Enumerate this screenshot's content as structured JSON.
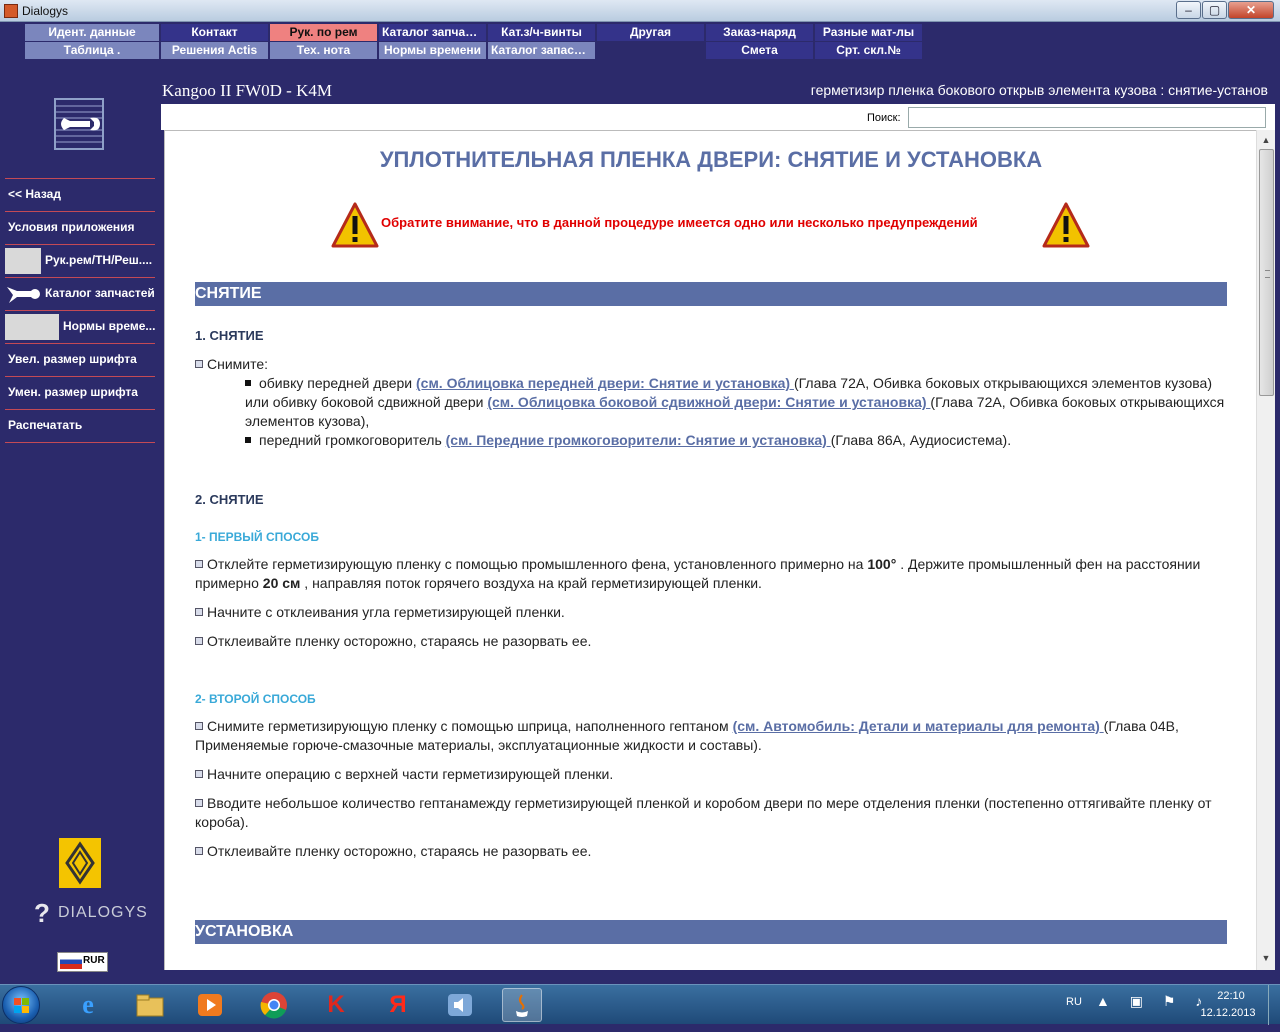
{
  "window": {
    "title": "Dialogys",
    "min_glyph": "–",
    "max_glyph": "▢",
    "close_glyph": "✕"
  },
  "menu": {
    "row1": [
      "Идент. данные",
      "Контакт",
      "Рук. по рем",
      "Каталог запчастей",
      "Кат.з/ч-винты",
      "Другая",
      "Заказ-наряд",
      "Разные мат-лы"
    ],
    "row2": [
      "Таблица .",
      "Решения Actis",
      "Тех. нота",
      "Нормы времени",
      "Каталог запасны...",
      "Смета",
      "Срт. скл.№"
    ],
    "active_index": 2,
    "colors": {
      "light": "#7b86bd",
      "dark": "#34338a",
      "active": "#ef8180"
    }
  },
  "sidebar": {
    "items": [
      "<< Назад",
      "Условия приложения",
      "Рук.рем/ТН/Реш....",
      "Каталог запчастей",
      "Нормы време...",
      "Увел. размер шрифта",
      "Умен. размер шрифта",
      "Распечатать"
    ],
    "brand": "DIALOGYS",
    "brand_mark": "?",
    "currency": "RUR"
  },
  "header": {
    "vehicle": "Kangoo II FW0D - K4M",
    "breadcrumb": "герметизир пленка бокового открыв элемента кузова : снятие-установ"
  },
  "search": {
    "label": "Поиск:",
    "value": ""
  },
  "doc": {
    "title": "УПЛОТНИТЕЛЬНАЯ ПЛЕНКА ДВЕРИ: СНЯТИЕ И УСТАНОВКА",
    "warning": "Обратите внимание, что в данной процедуре имеется одно или несколько предупреждений",
    "removal": {
      "section": "СНЯТИЕ",
      "step1": {
        "heading": "1. СНЯТИЕ",
        "intro": "Снимите:",
        "b1_a": "обивку передней двери ",
        "b1_link1": "(см. Облицовка передней двери: Снятие и установка) ",
        "b1_b": "(Глава 72A, Обивка боковых открывающихся элементов кузова) или обивку боковой сдвижной двери ",
        "b1_link2": "(см. Облицовка боковой сдвижной двери: Снятие и установка) ",
        "b1_c": "(Глава 72A, Обивка боковых открывающихся элементов кузова),",
        "b2_a": "передний громкоговоритель ",
        "b2_link": "(см. Передние громкоговорители: Снятие и установка) ",
        "b2_b": "(Глава 86A, Аудиосистема)."
      },
      "step2": {
        "heading": "2. СНЯТИЕ",
        "m1": {
          "heading": "1- ПЕРВЫЙ СПОСОБ",
          "p1_a": "Отклейте герметизирующую пленку с помощью промышленного фена, установленного примерно на ",
          "p1_temp": "100°",
          "p1_b": " . Держите промышленный фен на расстоянии примерно ",
          "p1_dist": "20 см",
          "p1_c": " , направляя поток горячего воздуха на край герметизирующей пленки.",
          "p2": "Начните с отклеивания угла герметизирующей пленки.",
          "p3": "Отклеивайте пленку осторожно, стараясь не разорвать ее."
        },
        "m2": {
          "heading": "2- ВТОРОЙ СПОСОБ",
          "p1_a": "Снимите герметизирующую пленку с помощью шприца, наполненного гептаном ",
          "p1_link": "(см. Автомобиль: Детали и материалы для ремонта) ",
          "p1_b": "(Глава 04B, Применяемые горюче-смазочные материалы, эксплуатационные жидкости и составы).",
          "p2": "Начните операцию с верхней части герметизирующей пленки.",
          "p3": "Вводите небольшое количество гептанамежду герметизирующей пленкой и коробом двери по мере отделения пленки (постепенно оттягивайте пленку от короба).",
          "p4": "Отклеивайте пленку осторожно, стараясь не разорвать ее."
        }
      }
    },
    "installation": {
      "section": "УСТАНОВКА"
    },
    "colors": {
      "title": "#5a6ea5",
      "section_bg": "#5a6ea5",
      "warning": "#e00000",
      "subheading": "#39a9d8",
      "link": "#5a6ea5"
    }
  },
  "scrollbar": {
    "up": "▲",
    "down": "▼"
  },
  "taskbar": {
    "apps": [
      "internet-explorer",
      "file-explorer",
      "media-player",
      "chrome",
      "kaspersky",
      "yandex",
      "audio",
      "java"
    ],
    "ie_glyph": "e",
    "yandex_glyph": "Я",
    "kaspersky_glyph": "K",
    "tray_lang": "RU",
    "time": "22:10",
    "date": "12.12.2013"
  }
}
